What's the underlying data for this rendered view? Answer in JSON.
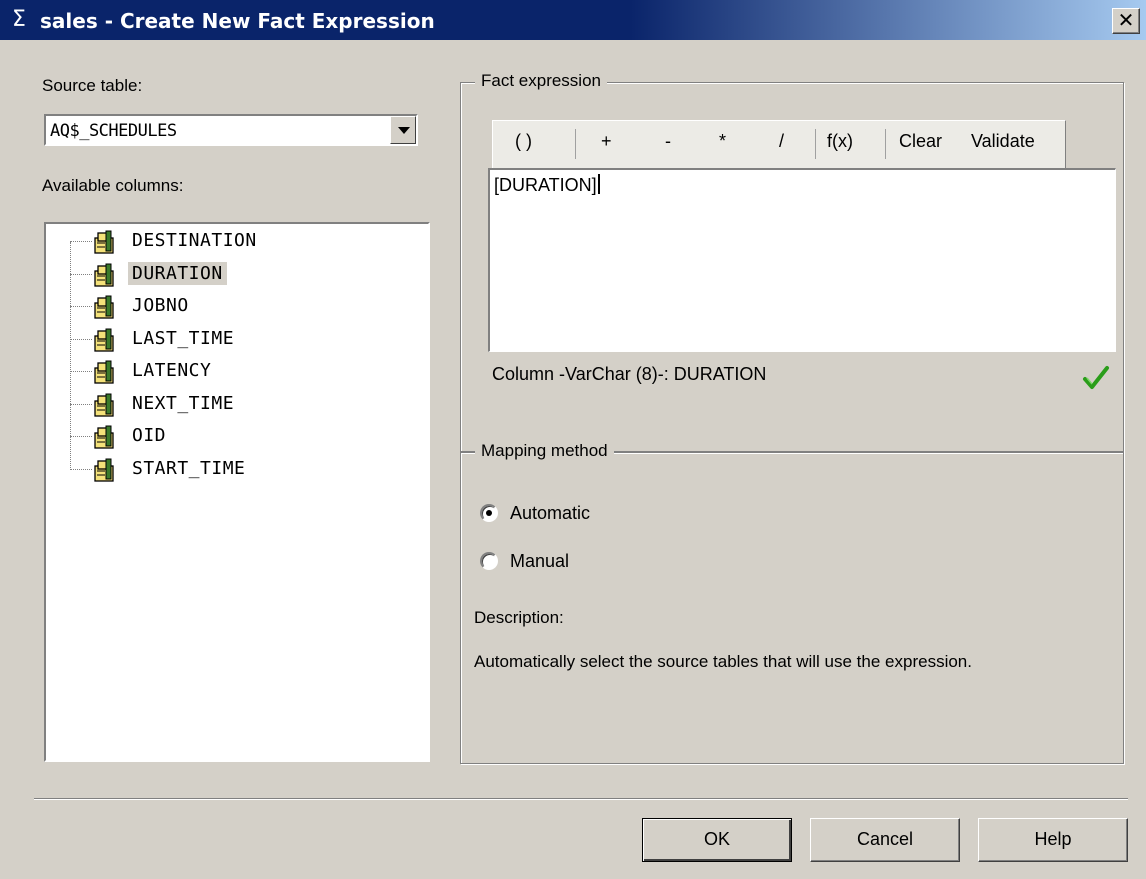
{
  "window": {
    "icon": "sigma-icon",
    "icon_glyph": "Σ",
    "title": "sales - Create New Fact Expression",
    "close_glyph": "✕"
  },
  "source": {
    "label": "Source table:",
    "selected": "AQ$_SCHEDULES"
  },
  "columns": {
    "label": "Available columns:",
    "items": [
      "DESTINATION",
      "DURATION",
      "JOBNO",
      "LAST_TIME",
      "LATENCY",
      "NEXT_TIME",
      "OID",
      "START_TIME"
    ],
    "selected": "DURATION"
  },
  "fact_expression": {
    "title": "Fact expression",
    "toolbar": {
      "parens": "( )",
      "plus": "+",
      "minus": "-",
      "multiply": "*",
      "divide": "/",
      "function": "f(x)",
      "clear": "Clear",
      "validate": "Validate"
    },
    "expression": "[DURATION]",
    "status": "Column -VarChar (8)-: DURATION",
    "valid_icon": "checkmark-icon"
  },
  "mapping": {
    "title": "Mapping method",
    "options": [
      {
        "label": "Automatic",
        "checked": true
      },
      {
        "label": "Manual",
        "checked": false
      }
    ],
    "description_label": "Description:",
    "description": "Automatically select the source tables that will use the expression."
  },
  "buttons": {
    "ok": "OK",
    "cancel": "Cancel",
    "help": "Help"
  },
  "colors": {
    "title_bar": "#0a246a",
    "face": "#d4d0c8",
    "check": "#2a9d1a"
  }
}
